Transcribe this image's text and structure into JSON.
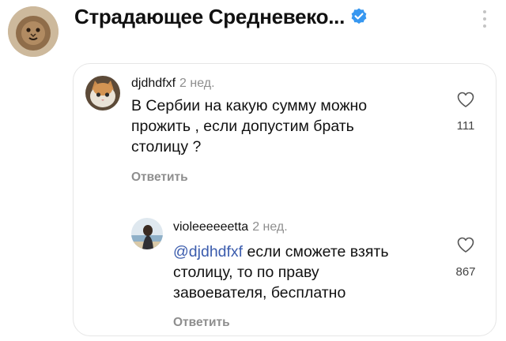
{
  "header": {
    "title": "Страдающее Средневеко...",
    "verified_icon": "verified-badge-icon",
    "more_icon": "more-vertical-icon",
    "accent_color": "#3797f0"
  },
  "comments": [
    {
      "username": "djdhdfxf",
      "time": "2 нед.",
      "text_lines": [
        "В Сербии на какую сумму можно",
        "прожить , если допустим брать",
        "столицу ?"
      ],
      "reply_label": "Ответить",
      "like_icon": "heart-outline-icon",
      "likes": "111"
    },
    {
      "username": "violeeeeeetta",
      "time": "2 нед.",
      "mention": "@djdhdfxf",
      "text_first": " если сможете взять",
      "text_lines": [
        "столицу, то по праву",
        "завоевателя, бесплатно"
      ],
      "reply_label": "Ответить",
      "like_icon": "heart-outline-icon",
      "likes": "867"
    }
  ]
}
